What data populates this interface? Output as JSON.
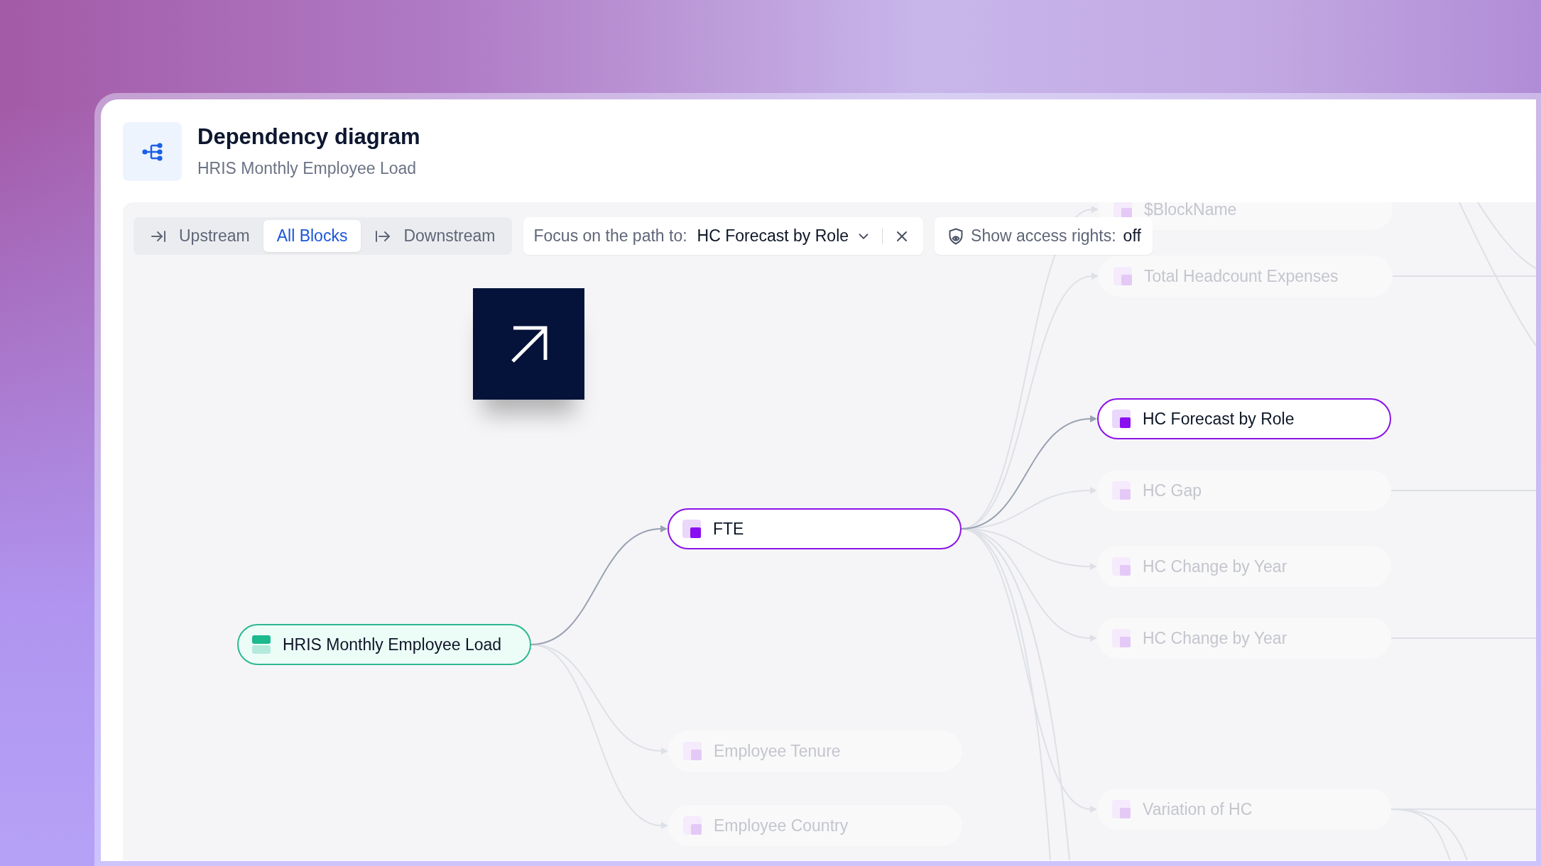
{
  "header": {
    "title": "Dependency diagram",
    "subtitle": "HRIS Monthly Employee Load"
  },
  "toolbar": {
    "direction_tabs": [
      {
        "label": "Upstream",
        "kind": "upstream",
        "selected": false
      },
      {
        "label": "All Blocks",
        "kind": "all",
        "selected": true
      },
      {
        "label": "Downstream",
        "kind": "downstream",
        "selected": false
      }
    ],
    "focus_path": {
      "label": "Focus on the path to:",
      "value": "HC Forecast by Role"
    },
    "access_rights": {
      "label": "Show access rights:",
      "value": "off"
    }
  },
  "diagram": {
    "root": {
      "name": "HRIS Monthly Employee Load",
      "kind": "dataset",
      "highlighted": true,
      "children": [
        {
          "name": "FTE",
          "kind": "block",
          "highlighted": true,
          "children": [
            {
              "name": "$BlockName",
              "kind": "block",
              "highlighted": false
            },
            {
              "name": "Total Headcount Expenses",
              "kind": "block",
              "highlighted": false
            },
            {
              "name": "HC Forecast by Role",
              "kind": "block",
              "highlighted": true
            },
            {
              "name": "HC Gap",
              "kind": "block",
              "highlighted": false
            },
            {
              "name": "HC Change by Year",
              "kind": "block",
              "highlighted": false
            },
            {
              "name": "HC Change by Year",
              "kind": "block",
              "highlighted": false
            },
            {
              "name": "Variation of HC",
              "kind": "block",
              "highlighted": false
            }
          ]
        },
        {
          "name": "Employee Tenure",
          "kind": "block",
          "highlighted": false
        },
        {
          "name": "Employee Country",
          "kind": "block",
          "highlighted": false
        }
      ]
    }
  }
}
